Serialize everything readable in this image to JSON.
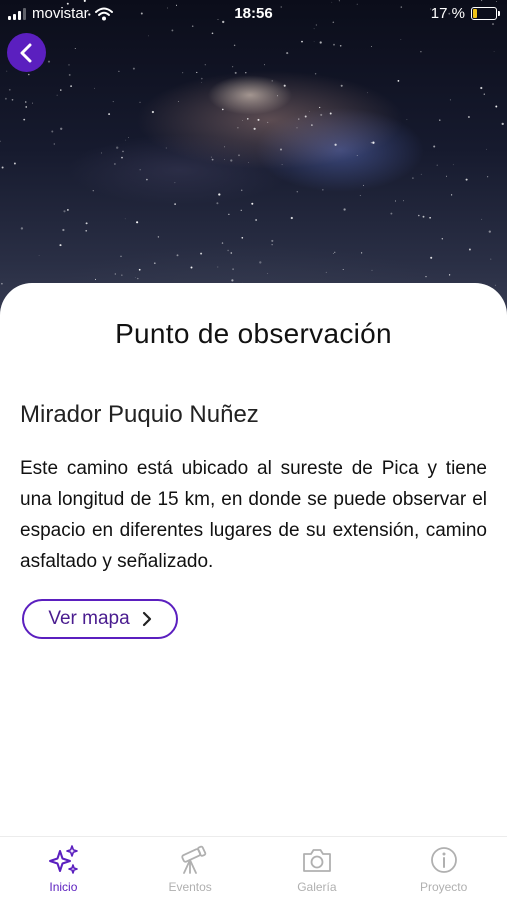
{
  "status_bar": {
    "carrier": "movistar",
    "time": "18:56",
    "battery_text": "17 %",
    "battery_level": 0.17
  },
  "header": {
    "back_icon": "chevron-left-icon",
    "accent_color": "#5b1fbf"
  },
  "content": {
    "page_title": "Punto de observación",
    "place_name": "Mirador Puquio Nuñez",
    "description": "Este camino está ubicado al sureste de Pica y tiene una longitud de 15 km, en donde se puede observar el espacio en diferentes lugares de su extensión, camino asfaltado y señalizado.",
    "map_button": {
      "label": "Ver mapa",
      "icon": "chevron-right-icon"
    }
  },
  "tab_bar": {
    "tabs": [
      {
        "label": "Inicio",
        "icon": "sparkles-icon",
        "active": true
      },
      {
        "label": "Eventos",
        "icon": "telescope-icon",
        "active": false
      },
      {
        "label": "Galería",
        "icon": "camera-icon",
        "active": false
      },
      {
        "label": "Proyecto",
        "icon": "info-icon",
        "active": false
      }
    ]
  }
}
